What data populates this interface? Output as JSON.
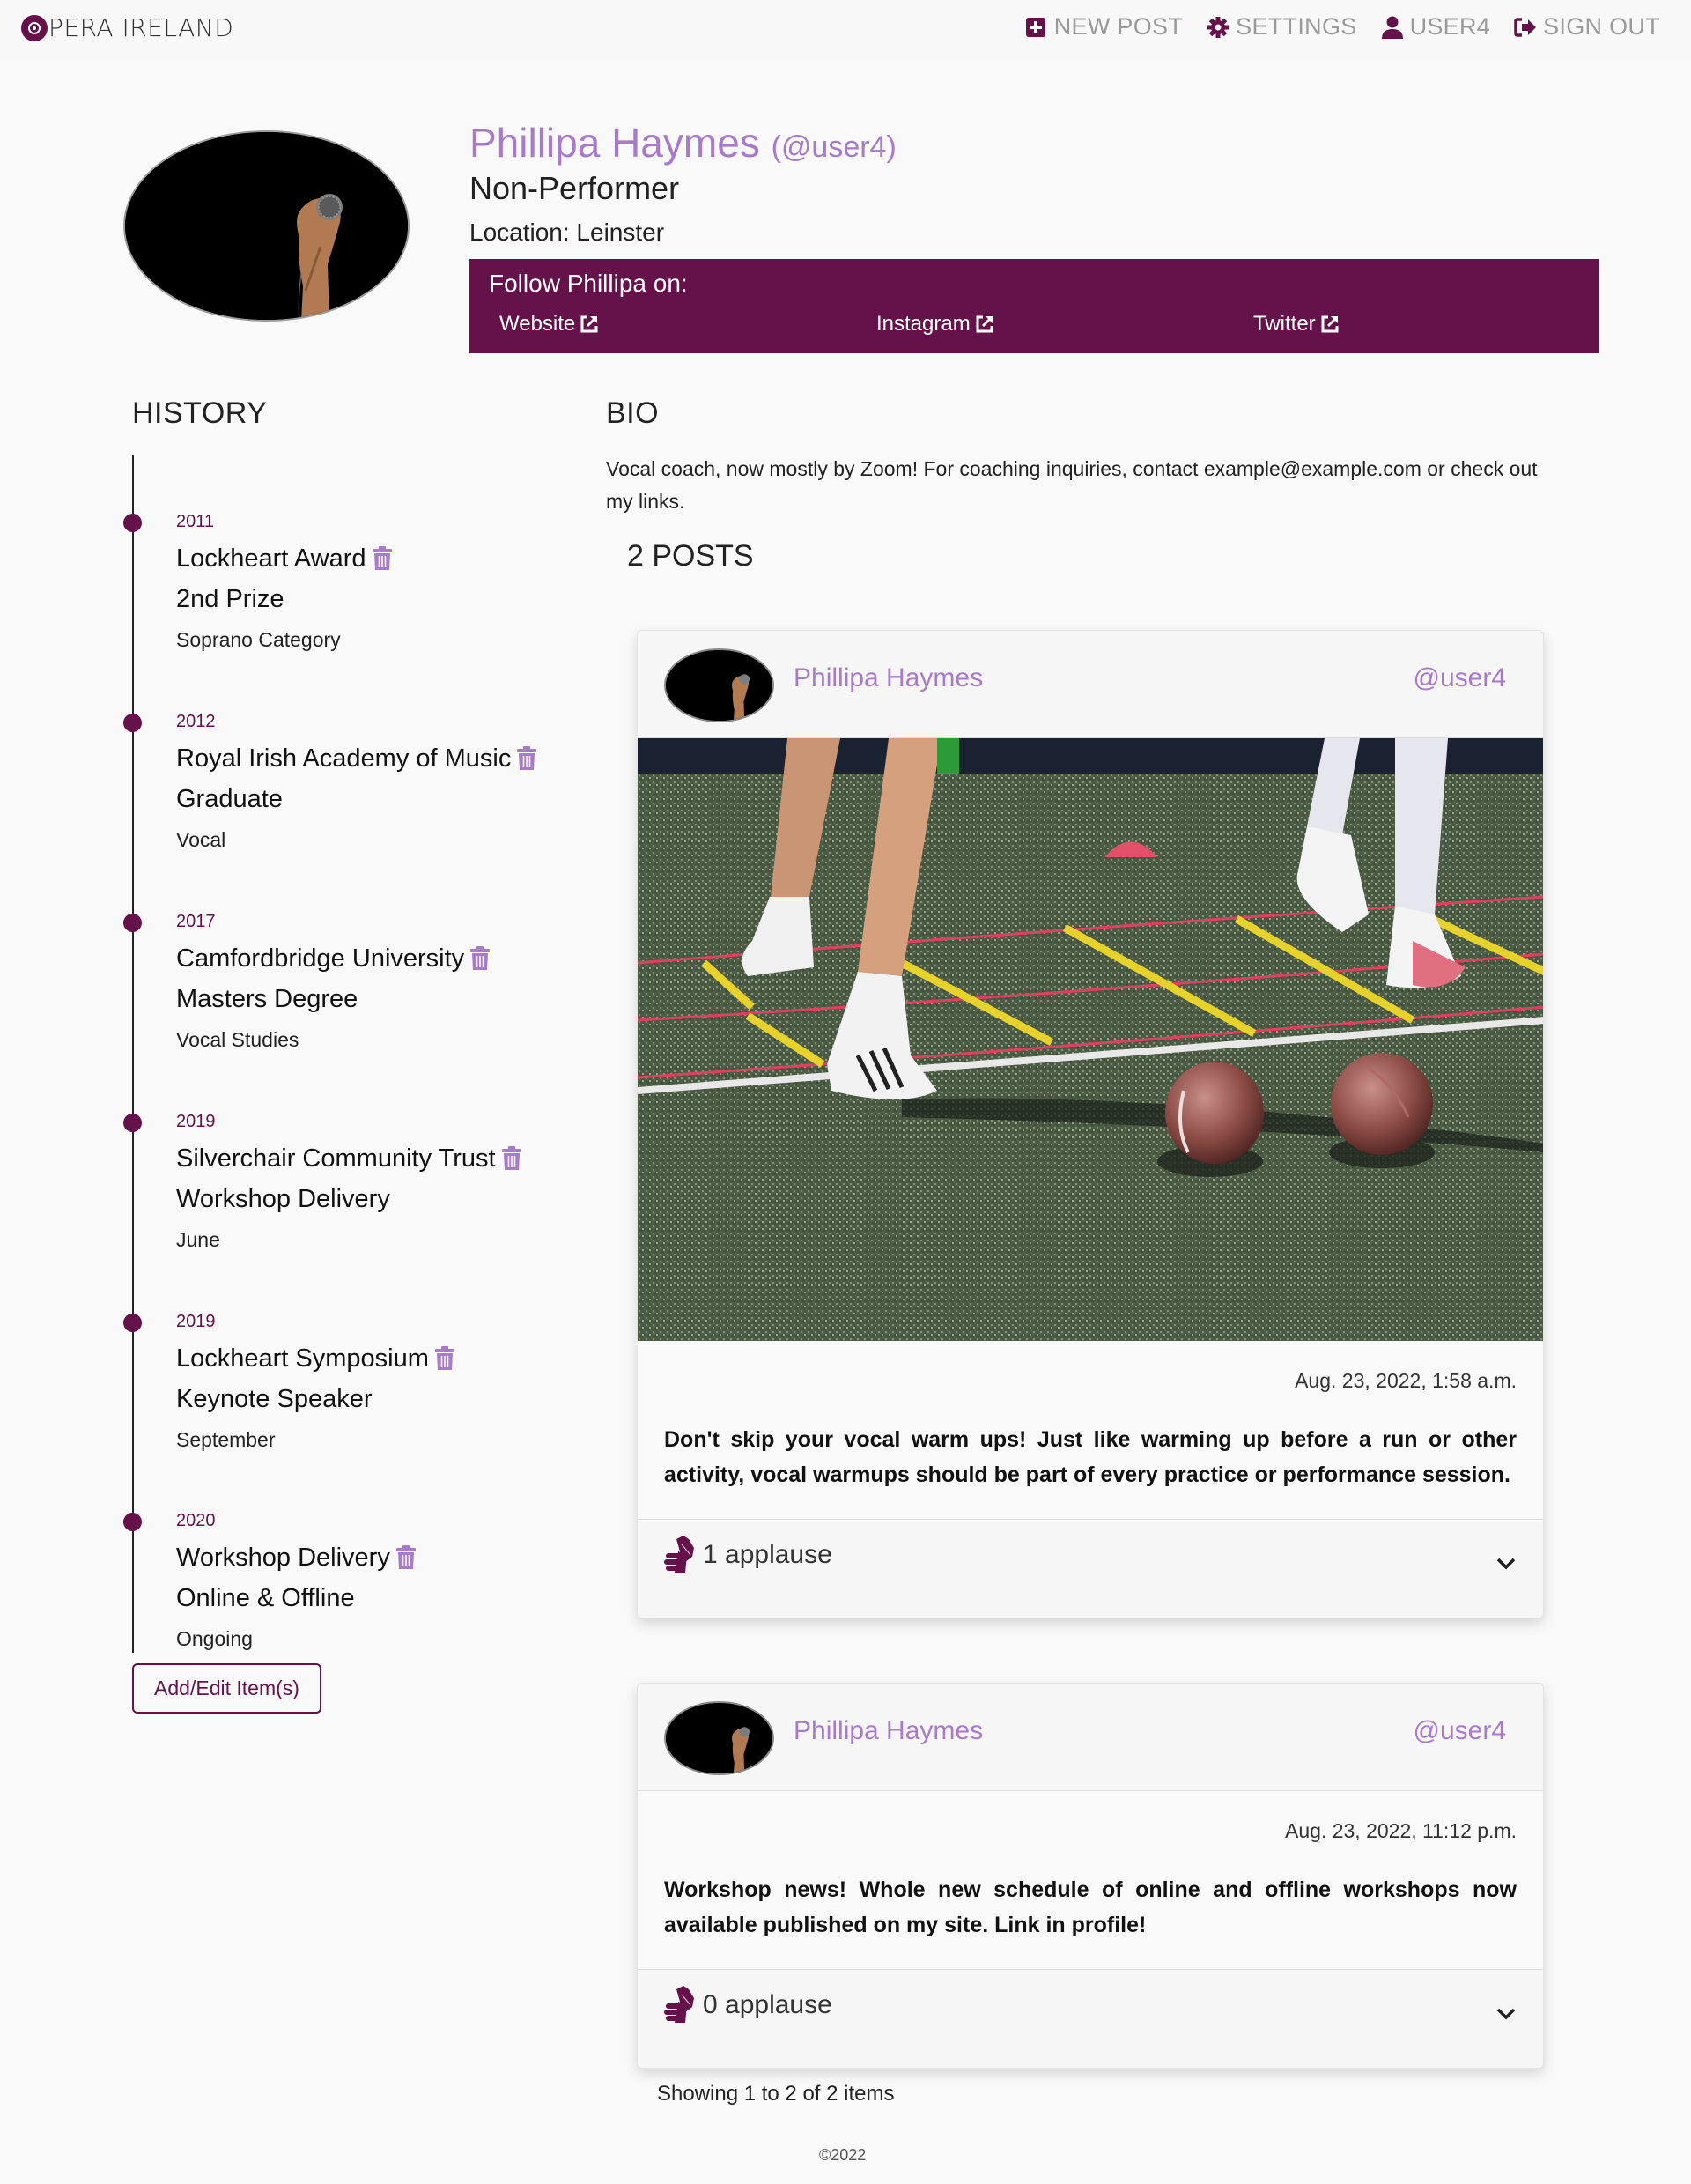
{
  "nav": {
    "brand": "PERA IRELAND",
    "brand_logo_icon": "vinyl-record-o-icon",
    "links": [
      {
        "label": "NEW POST",
        "icon": "plus-square-icon"
      },
      {
        "label": "SETTINGS",
        "icon": "gear-icon"
      },
      {
        "label": "USER4",
        "icon": "user-icon"
      },
      {
        "label": "SIGN OUT",
        "icon": "sign-out-icon"
      }
    ]
  },
  "profile": {
    "name": "Phillipa Haymes",
    "handle": "(@user4)",
    "role": "Non-Performer",
    "location": "Location: Leinster",
    "follow_title": "Follow Phillipa on:",
    "follow_links": [
      {
        "label": "Website"
      },
      {
        "label": "Instagram"
      },
      {
        "label": "Twitter"
      }
    ]
  },
  "history": {
    "heading": "HISTORY",
    "items": [
      {
        "year": "2011",
        "title": "Lockheart Award",
        "subtitle": "2nd Prize",
        "detail": "Soprano Category"
      },
      {
        "year": "2012",
        "title": "Royal Irish Academy of Music",
        "subtitle": "Graduate",
        "detail": "Vocal"
      },
      {
        "year": "2017",
        "title": "Camfordbridge University",
        "subtitle": "Masters Degree",
        "detail": "Vocal Studies"
      },
      {
        "year": "2019",
        "title": "Silverchair Community Trust",
        "subtitle": "Workshop Delivery",
        "detail": "June"
      },
      {
        "year": "2019",
        "title": "Lockheart Symposium",
        "subtitle": "Keynote Speaker",
        "detail": "September"
      },
      {
        "year": "2020",
        "title": "Workshop Delivery",
        "subtitle": "Online & Offline",
        "detail": "Ongoing"
      }
    ],
    "add_edit_label": "Add/Edit Item(s)"
  },
  "bio": {
    "heading": "BIO",
    "text": "Vocal coach, now mostly by Zoom! For coaching inquiries, contact example@example.com or check out my links."
  },
  "posts": {
    "count_label": "2 POSTS",
    "items": [
      {
        "author": "Phillipa Haymes",
        "handle": "@user4",
        "has_image": true,
        "image_alt": "Football training drill with agility ladder and two footballs on turf",
        "date": "Aug. 23, 2022, 1:58 a.m.",
        "text": "Don't skip your vocal warm ups! Just like warming up before a run or other activity, vocal warmups should be part of every practice or performance session.",
        "applause": "1 applause"
      },
      {
        "author": "Phillipa Haymes",
        "handle": "@user4",
        "has_image": false,
        "date": "Aug. 23, 2022, 11:12 p.m.",
        "text": "Workshop news! Whole new schedule of online and offline workshops now available published on my site. Link in profile!",
        "applause": "0 applause"
      }
    ],
    "pagination": "Showing 1 to 2 of 2 items"
  },
  "footer": {
    "copyright": "©2022"
  },
  "colors": {
    "brand": "#66124a",
    "accent_light": "#a77bca",
    "background": "#f9f9f9"
  }
}
